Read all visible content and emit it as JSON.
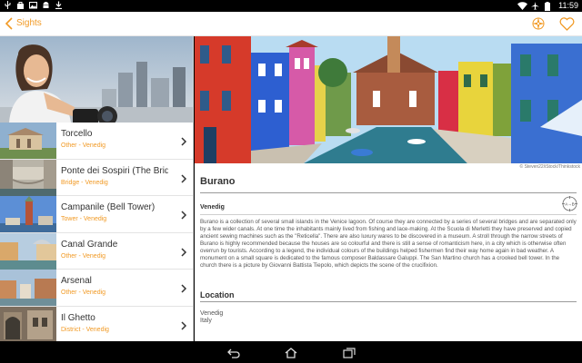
{
  "status_bar": {
    "time": "11:59",
    "left_icons": [
      "usb-icon",
      "bag-icon",
      "image-icon",
      "android-icon",
      "download-icon"
    ],
    "right_icons": [
      "wifi-icon",
      "airplane-icon",
      "battery-icon"
    ]
  },
  "header": {
    "title": "Sights",
    "icons": [
      "back-icon",
      "compass-icon",
      "heart-icon"
    ],
    "accent_color": "#f19a25"
  },
  "sights": [
    {
      "title": "Torcello",
      "subtitle": "Other - Venedig"
    },
    {
      "title": "Ponte dei Sospiri (The Brid…",
      "subtitle": "Bridge - Venedig"
    },
    {
      "title": "Campanile (Bell Tower)",
      "subtitle": "Tower - Venedig"
    },
    {
      "title": "Canal Grande",
      "subtitle": "Other - Venedig"
    },
    {
      "title": "Arsenal",
      "subtitle": "Other - Venedig"
    },
    {
      "title": "Il Ghetto",
      "subtitle": "District - Venedig"
    }
  ],
  "detail": {
    "image_credit": "© Steven22/iStock/Thinkstock",
    "title": "Burano",
    "city": "Venedig",
    "description": "Burano is a collection of several small islands in the Venice lagoon. Of course they are connected by a series of several bridges and are separated only by a few wider canals. At one time the inhabitants mainly lived from fishing and lace-making. At the Scuola di Merletti they have preserved and copied ancient sewing machines such as the \"Reticella\". There are also luxury wares to be discovered in a museum. A stroll through the narrow streets of Burano is highly recommended because the houses are so colourful and there is still a sense of romanticism here, in a city which is otherwise often overrun by tourists. According to a legend, the individual colours of the buildings helped fishermen find their way home again in bad weather. A monument on a small square is dedicated to the famous composer Baldassare Galuppi. The San Martino church has a crooked bell tower. In the church there is a picture by Giovanni Battista Tiepolo, which depicts the scene of the crucifixion.",
    "location_heading": "Location",
    "location_lines": [
      "Venedig",
      "Italy"
    ],
    "ab_badge": "A→B"
  },
  "nav_bar": {
    "icons": [
      "back-nav-icon",
      "home-nav-icon",
      "recents-nav-icon"
    ]
  }
}
